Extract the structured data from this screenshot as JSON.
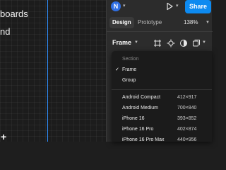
{
  "canvas": {
    "text_line1": "boards",
    "text_line2": "nd"
  },
  "topbar": {
    "avatar_initial": "N",
    "share_label": "Share"
  },
  "tabs": {
    "design": "Design",
    "prototype": "Prototype",
    "zoom": "138%"
  },
  "frame_section": {
    "title": "Frame",
    "icons": [
      "frame-tool-icon",
      "crosshair-icon",
      "half-circle-icon",
      "stack-icon"
    ]
  },
  "menu": {
    "header": "Section",
    "items": [
      {
        "label": "Frame",
        "checked": true
      },
      {
        "label": "Group",
        "checked": false
      }
    ],
    "presets": [
      {
        "name": "Android Compact",
        "dims": "412×917"
      },
      {
        "name": "Android Medium",
        "dims": "700×840"
      },
      {
        "name": "iPhone 16",
        "dims": "393×852"
      },
      {
        "name": "iPhone 16 Pro",
        "dims": "402×874"
      },
      {
        "name": "iPhone 16 Pro Max",
        "dims": "440×956"
      }
    ]
  },
  "colors": {
    "accent": "#0d8af0",
    "frame_edge": "#2f8fff",
    "avatar": "#2f6fe4"
  }
}
